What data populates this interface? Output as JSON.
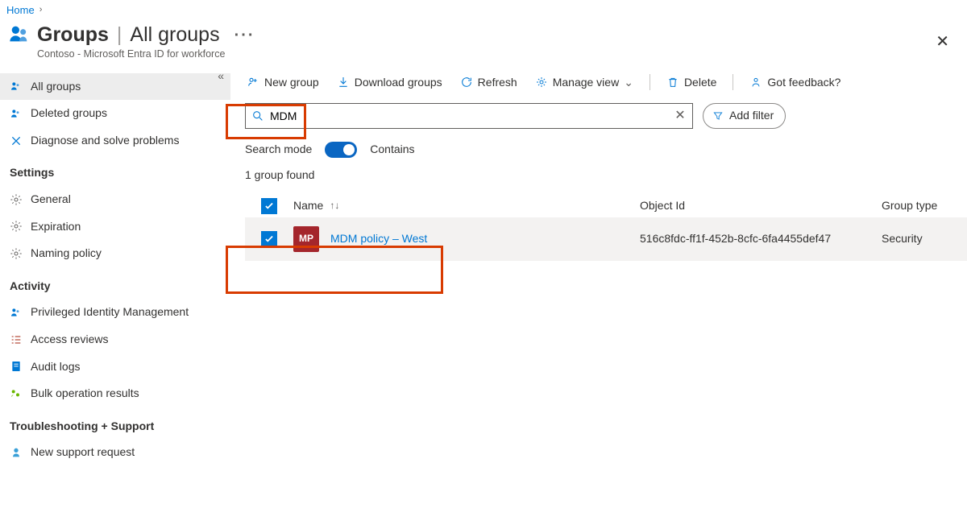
{
  "breadcrumb": {
    "home": "Home"
  },
  "header": {
    "title_main": "Groups",
    "title_suffix": "All groups",
    "subtitle": "Contoso - Microsoft Entra ID for workforce"
  },
  "sidebar": {
    "items": [
      {
        "label": "All groups",
        "icon": "groups"
      },
      {
        "label": "Deleted groups",
        "icon": "groups"
      },
      {
        "label": "Diagnose and solve problems",
        "icon": "diagnose"
      }
    ],
    "section_settings": "Settings",
    "settings": [
      {
        "label": "General",
        "icon": "gear"
      },
      {
        "label": "Expiration",
        "icon": "gear"
      },
      {
        "label": "Naming policy",
        "icon": "gear"
      }
    ],
    "section_activity": "Activity",
    "activity": [
      {
        "label": "Privileged Identity Management",
        "icon": "groups"
      },
      {
        "label": "Access reviews",
        "icon": "reviews"
      },
      {
        "label": "Audit logs",
        "icon": "log"
      },
      {
        "label": "Bulk operation results",
        "icon": "bulk"
      }
    ],
    "section_support": "Troubleshooting + Support",
    "support": [
      {
        "label": "New support request",
        "icon": "support"
      }
    ]
  },
  "toolbar": {
    "new_group": "New group",
    "download": "Download groups",
    "refresh": "Refresh",
    "manage_view": "Manage view",
    "delete": "Delete",
    "feedback": "Got feedback?"
  },
  "search": {
    "value": "MDM",
    "mode_label": "Search mode",
    "mode_value": "Contains",
    "found_text": "1 group found",
    "add_filter": "Add filter"
  },
  "table": {
    "cols": {
      "name": "Name",
      "object_id": "Object Id",
      "group_type": "Group type"
    },
    "rows": [
      {
        "initials": "MP",
        "name": "MDM policy – West",
        "oid": "516c8fdc-ff1f-452b-8cfc-6fa4455def47",
        "type": "Security"
      }
    ]
  }
}
